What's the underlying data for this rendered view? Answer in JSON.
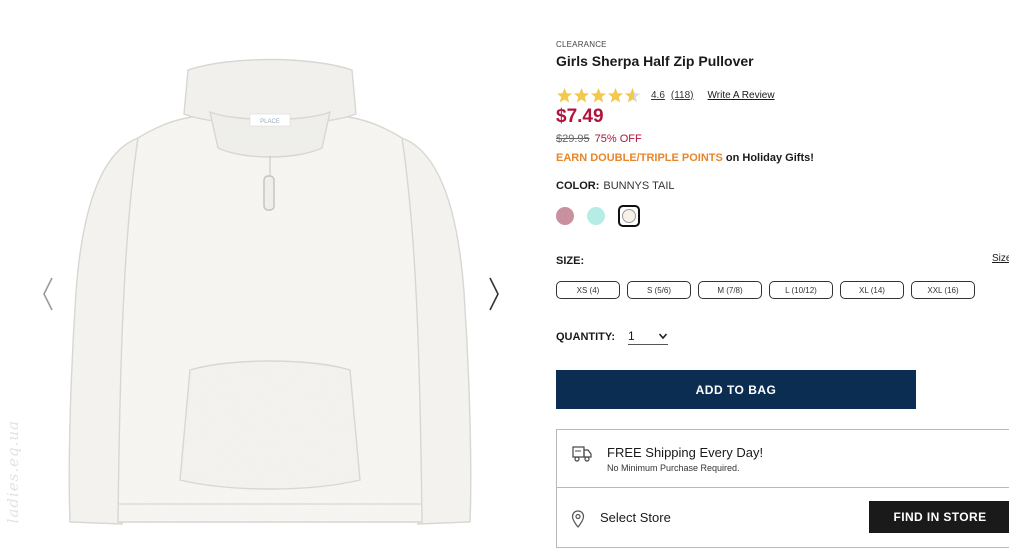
{
  "gallery": {
    "prev_icon": "chevron-left-icon",
    "next_icon": "chevron-right-icon",
    "image_label": "PLACE",
    "watermark": "ladies.eq.ua"
  },
  "product": {
    "badge": "CLEARANCE",
    "title": "Girls Sherpa Half Zip Pullover",
    "rating": {
      "stars": 4.6,
      "value": "4.6",
      "count": "(118)",
      "write_review": "Write A Review",
      "star_color": "#f2c94c"
    },
    "price": "$7.49",
    "original_price": "$29.95",
    "discount": "75% OFF",
    "promo": {
      "highlight": "EARN DOUBLE/TRIPLE POINTS",
      "rest": " on Holiday Gifts!"
    },
    "color": {
      "label": "COLOR:",
      "value": "BUNNYS TAIL",
      "swatches": [
        {
          "name": "mauve",
          "hex": "#c9919f"
        },
        {
          "name": "mint",
          "hex": "#b6ece6"
        },
        {
          "name": "bunnys-tail",
          "hex": "#f7f1e8",
          "selected": true
        }
      ]
    },
    "size": {
      "label": "SIZE:",
      "guide": "Size",
      "options": [
        "XS (4)",
        "S (5/6)",
        "M (7/8)",
        "L (10/12)",
        "XL (14)",
        "XXL (16)"
      ]
    },
    "quantity": {
      "label": "QUANTITY:",
      "value": "1"
    },
    "add_to_bag": "ADD TO BAG"
  },
  "fulfillment": {
    "shipping_title": "FREE Shipping Every Day!",
    "shipping_sub": "No Minimum Purchase Required.",
    "select_store": "Select Store",
    "find_in_store": "FIND IN STORE"
  },
  "colors": {
    "brand_navy": "#0c2d52",
    "sale_red": "#b0143d",
    "promo_orange": "#e8862a"
  }
}
